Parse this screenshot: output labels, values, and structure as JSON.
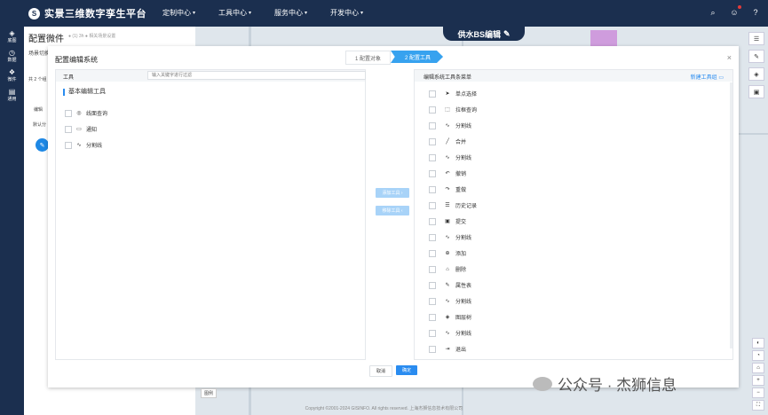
{
  "app": {
    "logo_char": "S",
    "title": "实景三维数字孪生平台"
  },
  "topnav": [
    {
      "label": "定制中心",
      "caret": "▾"
    },
    {
      "label": "工具中心",
      "caret": "▾"
    },
    {
      "label": "服务中心",
      "caret": "▾"
    },
    {
      "label": "开发中心",
      "caret": "▾"
    }
  ],
  "sidebar": [
    {
      "label": "底图",
      "icon": "layers-icon",
      "glyph": "◈"
    },
    {
      "label": "数据",
      "icon": "clock-icon",
      "glyph": "◷"
    },
    {
      "label": "微件",
      "icon": "widget-icon",
      "glyph": "❖"
    },
    {
      "label": "通用",
      "icon": "doc-icon",
      "glyph": "▤"
    }
  ],
  "panel": {
    "title": "配置微件",
    "hint": "● (1) 3h  ● 相关场景设置",
    "scene_label": "场景切换",
    "count_label": "共 2 个组",
    "edit_label": "编辑",
    "default_label": "默认分",
    "edit_glyph": "✎"
  },
  "banner": {
    "text": "供水BS编辑"
  },
  "dialog": {
    "title": "配置编辑系统",
    "close": "×",
    "steps": [
      "1 配置对象",
      "2 配置工具"
    ],
    "left": {
      "header": "工具",
      "search_placeholder": "输入关键字进行过滤",
      "group": "基本编辑工具",
      "items": [
        {
          "label": "线面查询",
          "icon": "query-icon",
          "glyph": "◎"
        },
        {
          "label": "通知",
          "icon": "monitor-icon",
          "glyph": "▭"
        },
        {
          "label": "分割线",
          "icon": "wave-icon",
          "glyph": "∿"
        }
      ]
    },
    "add_button": "添加工具 ›",
    "remove_button": "移除工具 ‹",
    "right": {
      "header": "编辑系统工具条菜单",
      "new_group": "新建工具组",
      "items": [
        {
          "label": "单点选择",
          "icon": "cursor-icon",
          "glyph": "➤"
        },
        {
          "label": "拉框查询",
          "icon": "box-select-icon",
          "glyph": "⬚"
        },
        {
          "label": "分割线",
          "icon": "wave-icon",
          "glyph": "∿"
        },
        {
          "label": "合并",
          "icon": "line-icon",
          "glyph": "╱"
        },
        {
          "label": "分割线",
          "icon": "wave-icon",
          "glyph": "∿"
        },
        {
          "label": "撤销",
          "icon": "undo-icon",
          "glyph": "↶"
        },
        {
          "label": "重做",
          "icon": "redo-icon",
          "glyph": "↷"
        },
        {
          "label": "历史记录",
          "icon": "history-icon",
          "glyph": "☰"
        },
        {
          "label": "提交",
          "icon": "save-icon",
          "glyph": "▣"
        },
        {
          "label": "分割线",
          "icon": "wave-icon",
          "glyph": "∿"
        },
        {
          "label": "添加",
          "icon": "add-icon",
          "glyph": "⊕"
        },
        {
          "label": "删除",
          "icon": "delete-icon",
          "glyph": "⌂"
        },
        {
          "label": "属性表",
          "icon": "attribute-icon",
          "glyph": "✎"
        },
        {
          "label": "分割线",
          "icon": "wave-icon",
          "glyph": "∿"
        },
        {
          "label": "图层树",
          "icon": "layer-tree-icon",
          "glyph": "◈"
        },
        {
          "label": "分割线",
          "icon": "wave-icon",
          "glyph": "∿"
        },
        {
          "label": "退出",
          "icon": "exit-icon",
          "glyph": "⇥"
        }
      ]
    },
    "cancel": "取消",
    "ok": "确定"
  },
  "map_chip": "图例",
  "footer": "Copyright ©2001-2024 GISINFO. All rights reserved. 上海杰狮信息技术有限公司",
  "watermark": "公众号 · 杰狮信息"
}
